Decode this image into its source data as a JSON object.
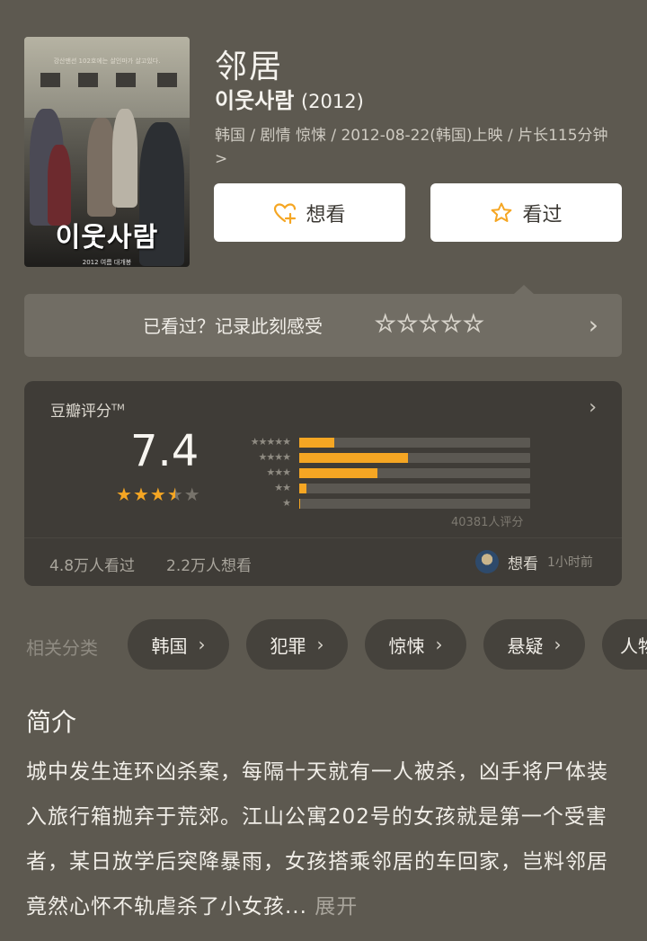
{
  "movie": {
    "title_cn": "邻居",
    "title_original": "이웃사람",
    "year": "(2012)",
    "meta": "韩国 / 剧情 惊悚 / 2012-08-22(韩国)上映 / 片长115分钟 >",
    "poster": {
      "title": "이웃사람",
      "tagline": "강산맨션 102호에는 살인마가 살고있다.",
      "release": "2012 여름 대개봉"
    }
  },
  "actions": {
    "want_label": "想看",
    "seen_label": "看过"
  },
  "record": {
    "prompt": "已看过？记录此刻感受",
    "star_count": 5
  },
  "rating": {
    "header": "豆瓣评分",
    "trademark": "TM",
    "score": "7.4",
    "stars_value": 3.5,
    "stars_max": 5,
    "distribution": [
      {
        "stars": "★★★★★",
        "fraction": 0.15
      },
      {
        "stars": "★★★★",
        "fraction": 0.47
      },
      {
        "stars": "★★★",
        "fraction": 0.34
      },
      {
        "stars": "★★",
        "fraction": 0.03
      },
      {
        "stars": "★",
        "fraction": 0.005
      }
    ],
    "count_text": "40381人评分",
    "watched": "4.8万人看过",
    "wishing": "2.2万人想看",
    "user_status": "想看",
    "user_time": "1小时前"
  },
  "categories": {
    "label": "相关分类",
    "items": [
      "韩国",
      "犯罪",
      "惊悚",
      "悬疑",
      "人物"
    ]
  },
  "intro": {
    "heading": "简介",
    "text": "城中发生连环凶杀案，每隔十天就有一人被杀，凶手将尸体装入旅行箱抛弃于荒郊。江山公寓202号的女孩就是第一个受害者，某日放学后突降暴雨，女孩搭乘邻居的车回家，岂料邻居竟然心怀不轨虐杀了小女孩...",
    "more": "展开"
  },
  "colors": {
    "background": "#5d5950",
    "star": "#f5a623",
    "card": "#3f3c37"
  }
}
